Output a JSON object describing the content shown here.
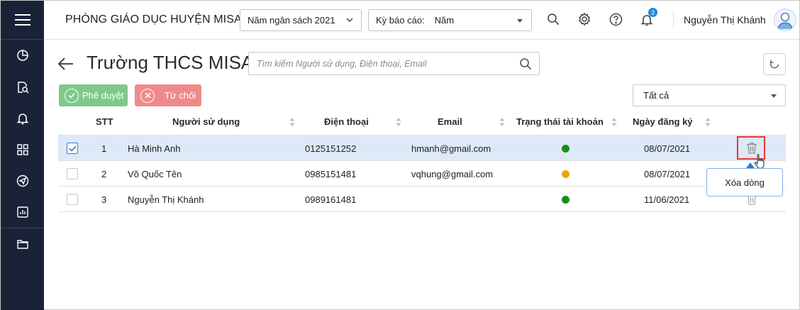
{
  "header": {
    "org_name": "PHÒNG GIÁO DỤC HUYỆN MISA",
    "budget_year": "Năm ngân sách 2021",
    "report_period_label": "Kỳ báo cáo:",
    "report_period_value": "Năm",
    "notification_count": "3",
    "user_name": "Nguyễn Thị Khánh"
  },
  "sidebar": {
    "items": [
      {
        "icon": "pie-chart-icon"
      },
      {
        "icon": "document-search-icon"
      },
      {
        "icon": "bell-icon"
      },
      {
        "icon": "grid-icon"
      },
      {
        "icon": "send-icon"
      },
      {
        "icon": "bar-chart-icon"
      },
      {
        "icon": "folder-icon"
      }
    ]
  },
  "page": {
    "title": "Trường THCS MISA",
    "search_placeholder": "Tìm kiếm Người sử dụng, Điện thoại, Email",
    "approve_label": "Phê duyệt",
    "reject_label": "Từ chối",
    "filter_value": "Tất cả"
  },
  "table": {
    "columns": [
      "STT",
      "Người sử dụng",
      "Điện thoại",
      "Email",
      "Trạng thái tài khoản",
      "Ngày đăng ký"
    ],
    "rows": [
      {
        "stt": "1",
        "user": "Hà Minh Anh",
        "phone": "0125151252",
        "email": "hmanh@gmail.com",
        "status_color": "#1a8f1a",
        "date": "08/07/2021",
        "checked": true
      },
      {
        "stt": "2",
        "user": "Võ Quốc Tên",
        "phone": "0985151481",
        "email": "vqhung@gmail.com",
        "status_color": "#f0a500",
        "date": "08/07/2021",
        "checked": false
      },
      {
        "stt": "3",
        "user": "Nguyễn Thị Khánh",
        "phone": "0989161481",
        "email": "",
        "status_color": "#1a8f1a",
        "date": "11/06/2021",
        "checked": false
      }
    ]
  },
  "tooltip": {
    "delete_row": "Xóa dòng"
  },
  "colors": {
    "sidebar_bg": "#1a2238",
    "approve": "#7ec98a",
    "reject": "#ef8a8a",
    "selected_row": "#dde9f7",
    "highlight": "#e53935"
  }
}
